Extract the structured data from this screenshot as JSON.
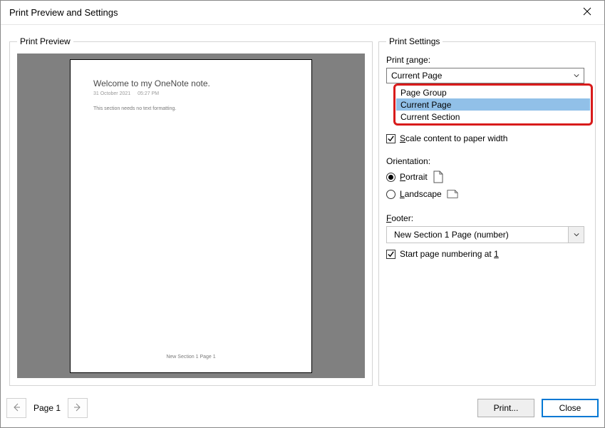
{
  "window": {
    "title": "Print Preview and Settings"
  },
  "preview": {
    "group_label": "Print Preview",
    "page": {
      "heading": "Welcome to my OneNote note.",
      "date": "31 October 2021",
      "time": "05:27 PM",
      "body": "This section needs no text formatting.",
      "footer": "New Section 1 Page 1"
    }
  },
  "settings": {
    "group_label": "Print Settings",
    "print_range": {
      "label_pre": "Print ",
      "label_key": "r",
      "label_post": "ange:",
      "selected": "Current Page",
      "options": [
        "Page Group",
        "Current Page",
        "Current Section"
      ],
      "selected_index": 1
    },
    "scale": {
      "checked": true,
      "label_pre": "",
      "label_key": "S",
      "label_post": "cale content to paper width"
    },
    "orientation": {
      "label": "Orientation:",
      "portrait": {
        "label_key": "P",
        "label_post": "ortrait",
        "checked": true
      },
      "landscape": {
        "label_key": "L",
        "label_post": "andscape",
        "checked": false
      }
    },
    "footer": {
      "label_key": "F",
      "label_post": "ooter:",
      "selected": "New Section 1 Page (number)"
    },
    "start_numbering": {
      "checked": true,
      "label_pre": "Start page numbering at ",
      "label_key": "1"
    }
  },
  "nav": {
    "page_indicator": "Page 1"
  },
  "buttons": {
    "print": "Print...",
    "close": "Close"
  }
}
